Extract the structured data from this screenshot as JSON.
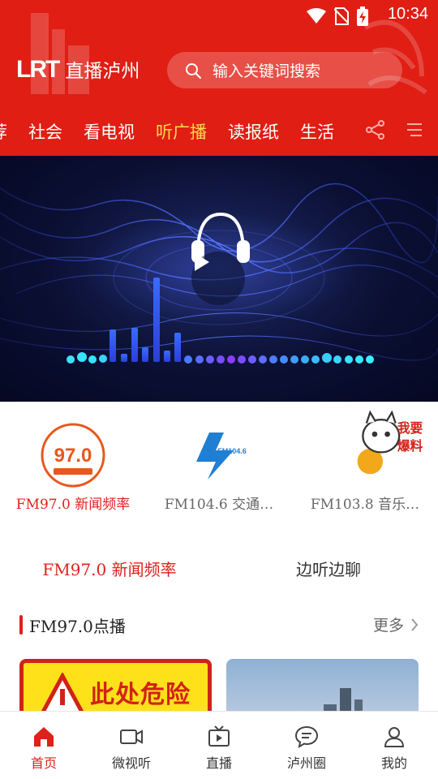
{
  "status_bar": {
    "time": "10:34"
  },
  "header": {
    "logo_mark": "LRT",
    "logo_text": "直播泸州",
    "search_placeholder": "输入关键词搜索",
    "accent_color": "#e01e14"
  },
  "tabs": [
    {
      "label": "荐",
      "active": false
    },
    {
      "label": "社会",
      "active": false
    },
    {
      "label": "看电视",
      "active": false
    },
    {
      "label": "听广播",
      "active": true
    },
    {
      "label": "读报纸",
      "active": false
    },
    {
      "label": "生活",
      "active": false
    }
  ],
  "player": {
    "state": "paused"
  },
  "stations": [
    {
      "label": "FM97.0 新闻频率",
      "logo_icon": "fm970-logo",
      "selected": true
    },
    {
      "label": "FM104.6 交通…",
      "logo_icon": "fm1046-logo",
      "selected": false
    },
    {
      "label": "FM103.8 音乐…",
      "logo_icon": "fm1038-logo",
      "selected": false
    }
  ],
  "logos": {
    "fm970_badge": "97.0",
    "fm1046_text": "FM104.6",
    "fm1038_text": "我要爆料"
  },
  "subtabs": [
    {
      "label": "FM97.0 新闻频率",
      "active": true
    },
    {
      "label": "边听边聊",
      "active": false
    }
  ],
  "section": {
    "title": "FM97.0点播",
    "more_label": "更多"
  },
  "thumbnails": [
    {
      "text": "此处危险"
    },
    {
      "text": ""
    }
  ],
  "bottom_nav": [
    {
      "label": "首页",
      "icon": "home-icon",
      "active": true
    },
    {
      "label": "微视听",
      "icon": "video-camera-icon",
      "active": false
    },
    {
      "label": "直播",
      "icon": "tv-play-icon",
      "active": false
    },
    {
      "label": "泸州圈",
      "icon": "chat-bubble-icon",
      "active": false
    },
    {
      "label": "我的",
      "icon": "user-icon",
      "active": false
    }
  ]
}
